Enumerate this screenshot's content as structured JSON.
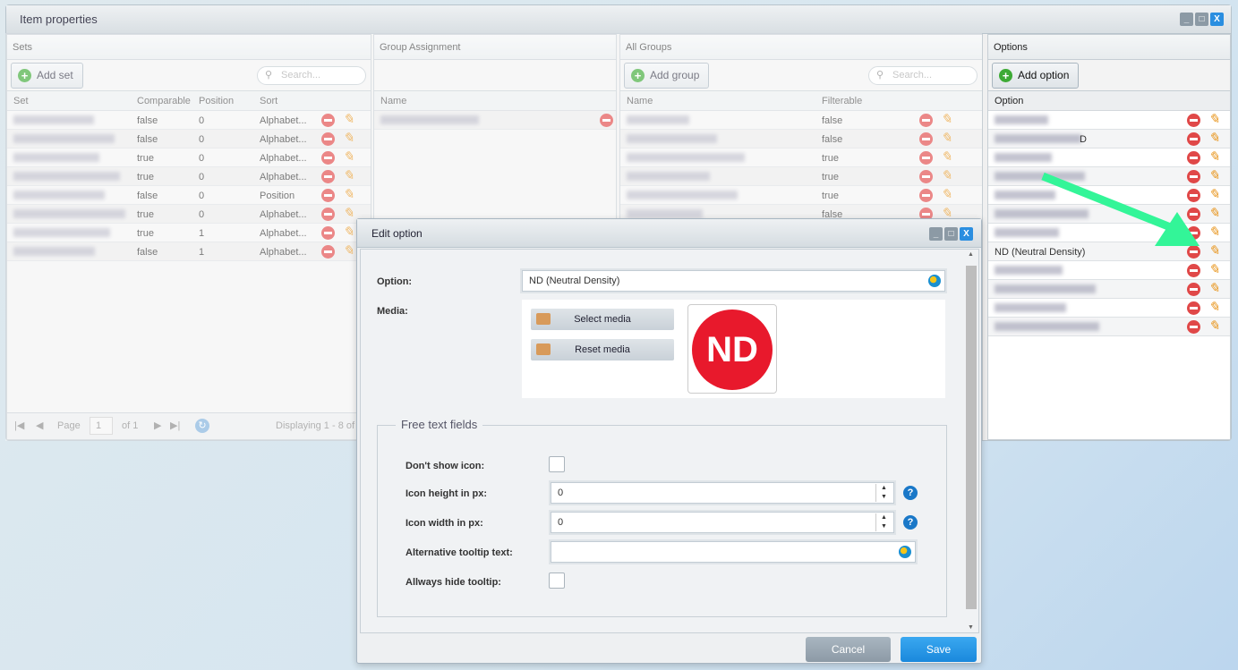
{
  "window": {
    "title": "Item properties"
  },
  "sets": {
    "title": "Sets",
    "add_label": "Add set",
    "search_placeholder": "Search...",
    "columns": [
      "Set",
      "Comparable",
      "Position",
      "Sort"
    ],
    "rows": [
      {
        "comparable": "false",
        "position": "0",
        "sort": "Alphabet..."
      },
      {
        "comparable": "false",
        "position": "0",
        "sort": "Alphabet..."
      },
      {
        "comparable": "true",
        "position": "0",
        "sort": "Alphabet..."
      },
      {
        "comparable": "true",
        "position": "0",
        "sort": "Alphabet..."
      },
      {
        "comparable": "false",
        "position": "0",
        "sort": "Position"
      },
      {
        "comparable": "true",
        "position": "0",
        "sort": "Alphabet..."
      },
      {
        "comparable": "true",
        "position": "1",
        "sort": "Alphabet..."
      },
      {
        "comparable": "false",
        "position": "1",
        "sort": "Alphabet..."
      }
    ],
    "pager": {
      "page_label": "Page",
      "page": "1",
      "of": "of 1",
      "displaying": "Displaying 1 - 8 of"
    }
  },
  "group_assignment": {
    "title": "Group Assignment",
    "columns": [
      "Name"
    ]
  },
  "all_groups": {
    "title": "All Groups",
    "add_label": "Add group",
    "search_placeholder": "Search...",
    "columns": [
      "Name",
      "Filterable"
    ],
    "rows": [
      "false",
      "false",
      "true",
      "true",
      "true",
      "false"
    ]
  },
  "options": {
    "title": "Options",
    "add_label": "Add option",
    "columns": [
      "Option"
    ],
    "rows": [
      "",
      "D",
      "",
      "",
      "",
      "",
      "",
      "ND (Neutral Density)",
      "",
      "",
      "",
      ""
    ]
  },
  "dialog": {
    "title": "Edit option",
    "option_label": "Option:",
    "option_value": "ND (Neutral Density)",
    "media_label": "Media:",
    "select_media": "Select media",
    "reset_media": "Reset media",
    "media_image_text": "ND",
    "fieldset_title": "Free text fields",
    "dont_show_icon": "Don't show icon:",
    "icon_height_label": "Icon height in px:",
    "icon_height": "0",
    "icon_width_label": "Icon width in px:",
    "icon_width": "0",
    "alt_tooltip_label": "Alternative tooltip text:",
    "alt_tooltip": "",
    "hide_tooltip_label": "Allways hide tooltip:",
    "cancel": "Cancel",
    "save": "Save"
  },
  "colors": {
    "accent": "#1a8ee0",
    "delete": "#e04848",
    "edit": "#e8951c",
    "arrow": "#33f598",
    "nd_red": "#e8192c"
  }
}
